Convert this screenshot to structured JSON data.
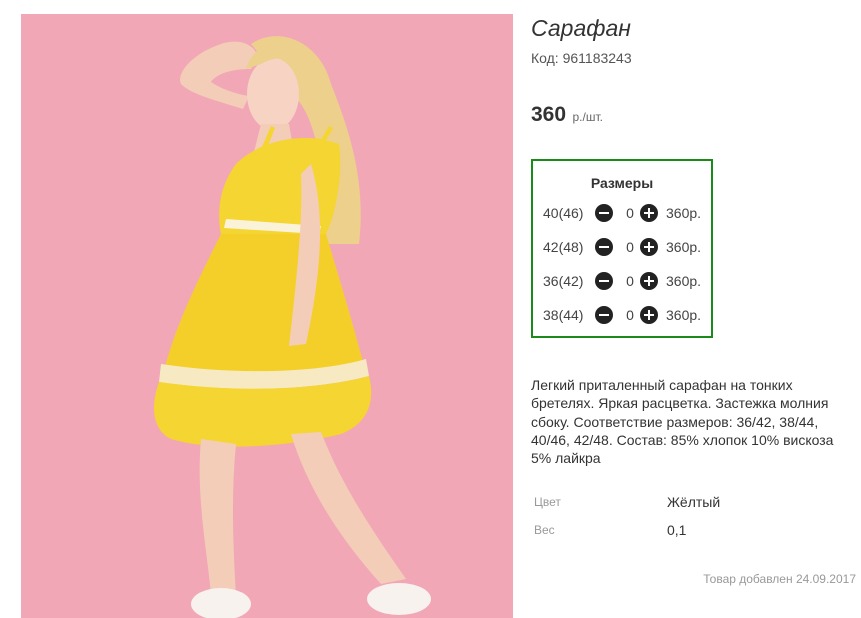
{
  "product": {
    "title": "Сарафан",
    "code": "Код: 961183243",
    "price": {
      "amount": "360",
      "unit": "р./шт."
    },
    "image_alt": "yellow-sundress-photo",
    "sizes": {
      "title": "Размеры",
      "rows": [
        {
          "label": "40(46)",
          "qty": "0",
          "price": "360р."
        },
        {
          "label": "42(48)",
          "qty": "0",
          "price": "360р."
        },
        {
          "label": "36(42)",
          "qty": "0",
          "price": "360р."
        },
        {
          "label": "38(44)",
          "qty": "0",
          "price": "360р."
        }
      ]
    },
    "description": "Легкий приталенный сарафан на тонких бретелях. Яркая расцветка. Застежка молния сбоку. Соответствие размеров: 36/42, 38/44, 40/46, 42/48. Состав: 85% хлопок 10% вискоза 5% лайкра",
    "attributes": [
      {
        "label": "Цвет",
        "value": "Жёлтый"
      },
      {
        "label": "Вес",
        "value": "0,1"
      }
    ],
    "added": "Товар добавлен 24.09.2017"
  },
  "colors": {
    "accent_border": "#1b8a1b",
    "photo_background": "#f2a7b6",
    "dress": "#f5d531"
  }
}
